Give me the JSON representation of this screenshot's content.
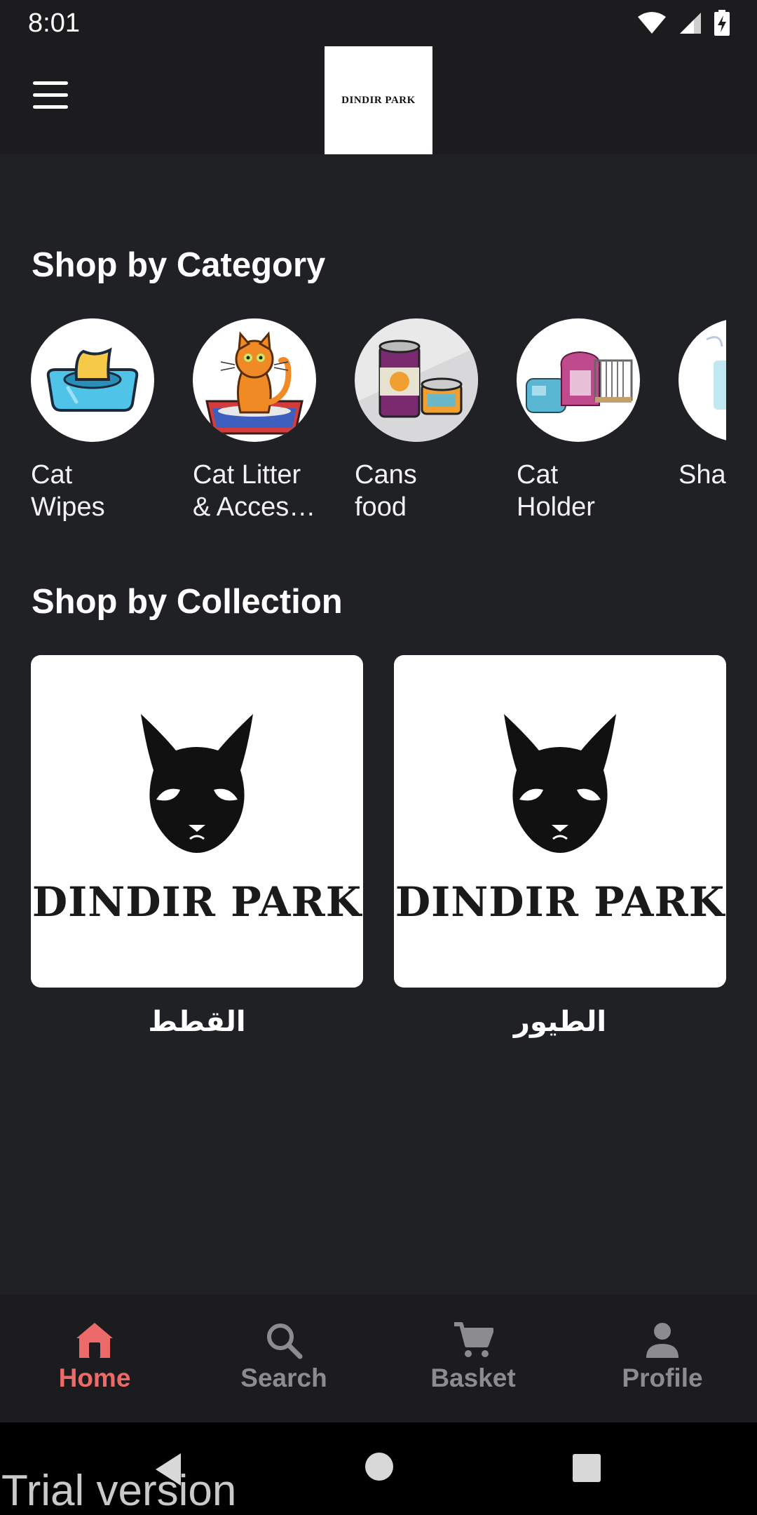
{
  "status": {
    "time": "8:01"
  },
  "header": {
    "logo_text": "DINDIR PARK"
  },
  "categories": {
    "title": "Shop by Category",
    "items": [
      {
        "label": "Cat\nWipes",
        "icon": "wipes-icon"
      },
      {
        "label": "Cat Litter\n& Acces…",
        "icon": "cat-litter-icon"
      },
      {
        "label": "Cans\nfood",
        "icon": "cans-food-icon"
      },
      {
        "label": "Cat\nHolder",
        "icon": "cat-carrier-icon"
      },
      {
        "label": "Sha",
        "icon": "shampoo-icon"
      }
    ]
  },
  "collections": {
    "title": "Shop by Collection",
    "items": [
      {
        "label": "القطط",
        "brand": "DINDIR PARK"
      },
      {
        "label": "الطيور",
        "brand": "DINDIR PARK"
      }
    ]
  },
  "nav": {
    "items": [
      {
        "label": "Home",
        "icon": "home-icon",
        "active": true
      },
      {
        "label": "Search",
        "icon": "search-icon",
        "active": false
      },
      {
        "label": "Basket",
        "icon": "cart-icon",
        "active": false
      },
      {
        "label": "Profile",
        "icon": "person-icon",
        "active": false
      }
    ]
  },
  "watermark": "Trial version",
  "colors": {
    "accent": "#ec6a6a",
    "background": "#202125",
    "bar": "#1c1c1f",
    "inactive": "#8c8c8f"
  }
}
